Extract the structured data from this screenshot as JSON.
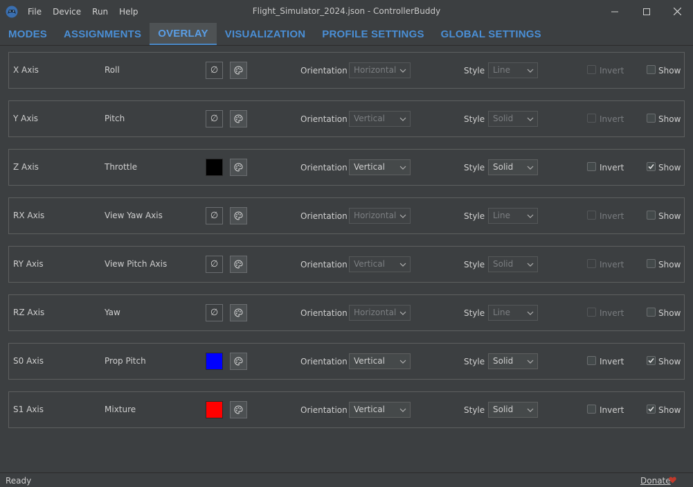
{
  "window": {
    "title": "Flight_Simulator_2024.json - ControllerBuddy",
    "menu": [
      "File",
      "Device",
      "Run",
      "Help"
    ],
    "controls": {
      "minimize": "minimize-icon",
      "maximize": "maximize-icon",
      "close": "close-icon"
    }
  },
  "tabs": [
    {
      "label": "MODES",
      "active": false
    },
    {
      "label": "ASSIGNMENTS",
      "active": false
    },
    {
      "label": "OVERLAY",
      "active": true
    },
    {
      "label": "VISUALIZATION",
      "active": false
    },
    {
      "label": "PROFILE SETTINGS",
      "active": false
    },
    {
      "label": "GLOBAL SETTINGS",
      "active": false
    }
  ],
  "labels": {
    "orientation": "Orientation",
    "style": "Style",
    "invert": "Invert",
    "show": "Show",
    "no_color_symbol": "∅"
  },
  "rows": [
    {
      "axis": "X Axis",
      "action": "Roll",
      "color": null,
      "orientation": "Horizontal",
      "style": "Line",
      "invert": false,
      "show": false,
      "enabled": false
    },
    {
      "axis": "Y Axis",
      "action": "Pitch",
      "color": null,
      "orientation": "Vertical",
      "style": "Solid",
      "invert": false,
      "show": false,
      "enabled": false
    },
    {
      "axis": "Z Axis",
      "action": "Throttle",
      "color": "#000000",
      "orientation": "Vertical",
      "style": "Solid",
      "invert": false,
      "show": true,
      "enabled": true
    },
    {
      "axis": "RX Axis",
      "action": "View Yaw Axis",
      "color": null,
      "orientation": "Horizontal",
      "style": "Line",
      "invert": false,
      "show": false,
      "enabled": false
    },
    {
      "axis": "RY Axis",
      "action": "View Pitch Axis",
      "color": null,
      "orientation": "Vertical",
      "style": "Solid",
      "invert": false,
      "show": false,
      "enabled": false
    },
    {
      "axis": "RZ Axis",
      "action": "Yaw",
      "color": null,
      "orientation": "Horizontal",
      "style": "Line",
      "invert": false,
      "show": false,
      "enabled": false
    },
    {
      "axis": "S0 Axis",
      "action": "Prop Pitch",
      "color": "#0000ff",
      "orientation": "Vertical",
      "style": "Solid",
      "invert": false,
      "show": true,
      "enabled": true
    },
    {
      "axis": "S1 Axis",
      "action": "Mixture",
      "color": "#ff0000",
      "orientation": "Vertical",
      "style": "Solid",
      "invert": false,
      "show": true,
      "enabled": true
    }
  ],
  "status": {
    "text": "Ready",
    "donate": "Donate",
    "heart_color": "#c0392b"
  },
  "colors": {
    "accent": "#4a8fd6",
    "background": "#3c3f41"
  }
}
